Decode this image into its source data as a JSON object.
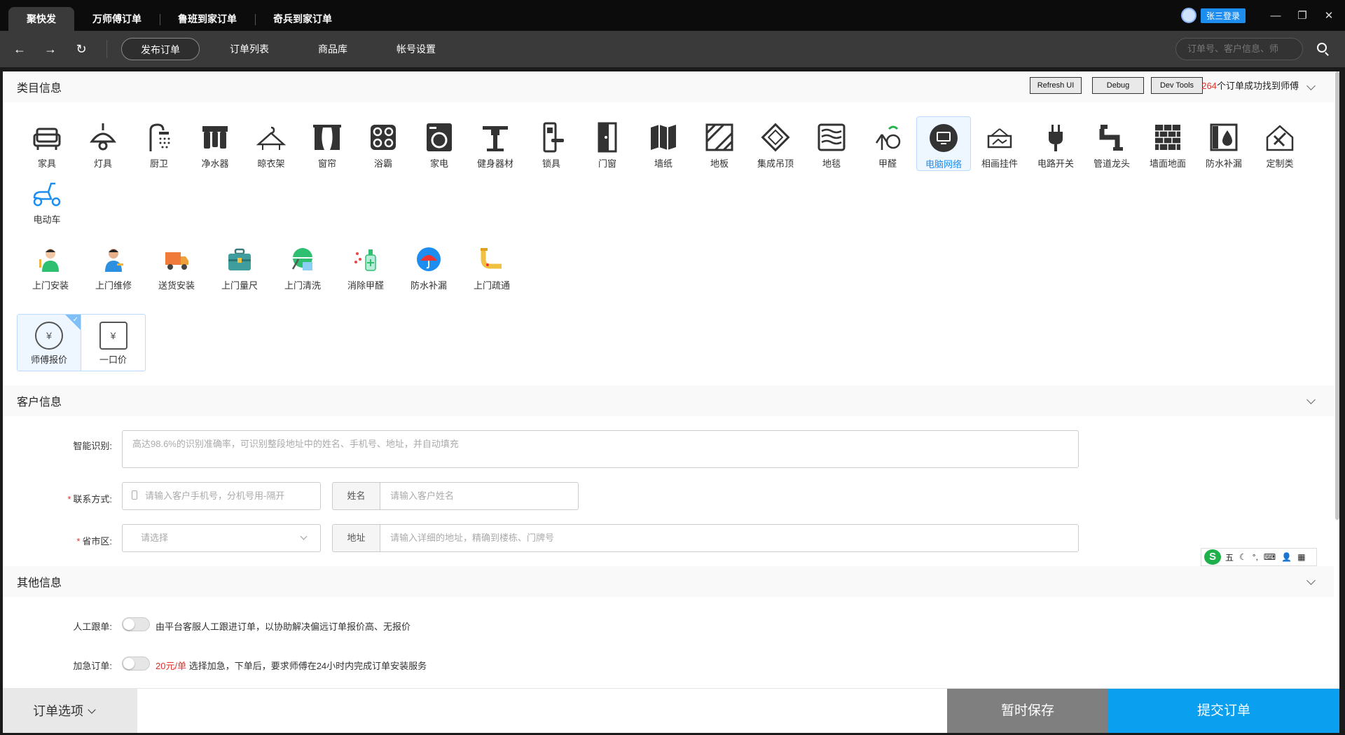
{
  "top_tabs": [
    "聚快发",
    "万师傅订单",
    "鲁班到家订单",
    "奇兵到家订单"
  ],
  "user": {
    "login_label": "张三登录"
  },
  "window_controls": {
    "minimize": "—",
    "restore": "❐",
    "close": "✕"
  },
  "nav": {
    "back": "←",
    "forward": "→",
    "refresh": "↻",
    "items": [
      "发布订单",
      "订单列表",
      "商品库",
      "帐号设置"
    ],
    "search_placeholder": "订单号、客户信息、师"
  },
  "category_section": {
    "title": "类目信息",
    "dev_buttons": [
      "Refresh UI",
      "Debug",
      "Dev Tools"
    ],
    "success_num": "264",
    "success_text": "个订单成功找到师傅",
    "categories": [
      "家具",
      "灯具",
      "厨卫",
      "净水器",
      "晾衣架",
      "窗帘",
      "浴霸",
      "家电",
      "健身器材",
      "锁具",
      "门窗",
      "墙纸",
      "地板",
      "集成吊顶",
      "地毯",
      "甲醛",
      "电脑网络",
      "相画挂件",
      "电路开关",
      "管道龙头",
      "墙面地面",
      "防水补漏",
      "定制类",
      "电动车"
    ],
    "active_category": "电脑网络",
    "services": [
      "上门安装",
      "上门维修",
      "送货安装",
      "上门量尺",
      "上门清洗",
      "消除甲醛",
      "防水补漏",
      "上门疏通"
    ],
    "pricing": [
      "师傅报价",
      "一口价"
    ],
    "check_mark": "✓",
    "price_symbol": "¥"
  },
  "customer_section": {
    "title": "客户信息",
    "smart_label": "智能识别:",
    "smart_placeholder": "高达98.6%的识别准确率，可识别整段地址中的姓名、手机号、地址，并自动填充",
    "contact_label": "联系方式:",
    "required_mark": "*",
    "phone_placeholder": "请输入客户手机号，分机号用-隔开",
    "name_addon": "姓名",
    "name_placeholder": "请输入客户姓名",
    "region_label": "省市区:",
    "region_placeholder": "请选择",
    "address_addon": "地址",
    "address_placeholder": "请输入详细的地址，精确到楼栋、门牌号"
  },
  "other_section": {
    "title": "其他信息",
    "manual_label": "人工跟单:",
    "manual_text": "由平台客服人工跟进订单，以协助解决偏远订单报价高、无报价",
    "urgent_label": "加急订单:",
    "urgent_price": "20元/单",
    "urgent_text": "选择加急，下单后，要求师傅在24小时内完成订单安装服务"
  },
  "ime": {
    "logo": "S",
    "mode": "五",
    "glyphs": [
      "☾",
      "°,",
      "⌨",
      "👤",
      "▦"
    ]
  },
  "footer": {
    "options_label": "订单选项",
    "save_label": "暂时保存",
    "submit_label": "提交订单"
  },
  "colors": {
    "accent": "#0b9ff0",
    "required": "#e0322c",
    "dark_bar": "#3a3a3a"
  }
}
